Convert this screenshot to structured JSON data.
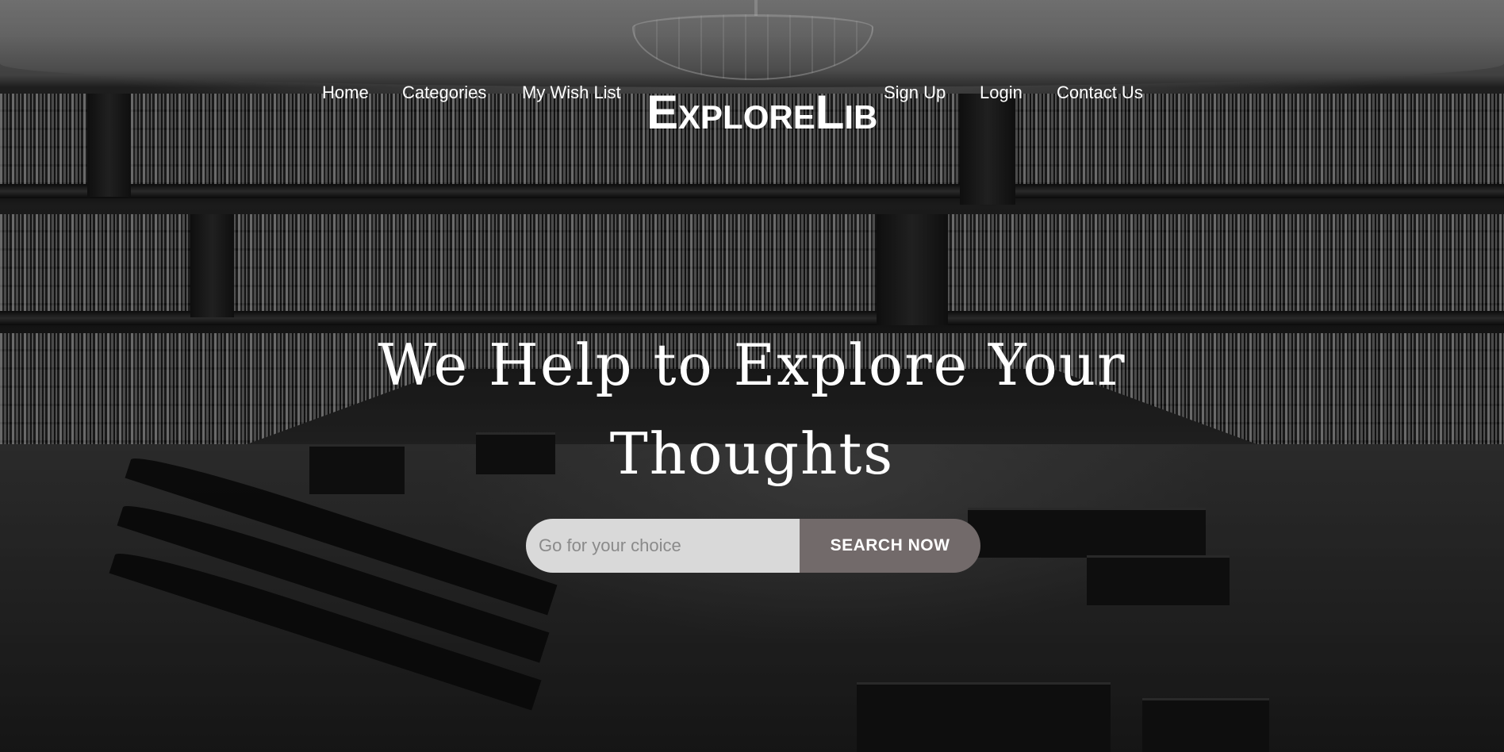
{
  "nav": {
    "left_links": [
      "Home",
      "Categories",
      "My Wish List"
    ],
    "brand": "ExploreLib",
    "right_links": [
      "Sign Up",
      "Login",
      "Contact Us"
    ]
  },
  "hero": {
    "headline_line1": "We Help to Explore Your",
    "headline_line2": "Thoughts"
  },
  "search": {
    "placeholder": "Go for your choice",
    "button_label": "SEARCH NOW"
  },
  "colors": {
    "search_button": "#726a6a",
    "search_input": "#d9d9d9",
    "text": "#ffffff"
  },
  "icons": []
}
